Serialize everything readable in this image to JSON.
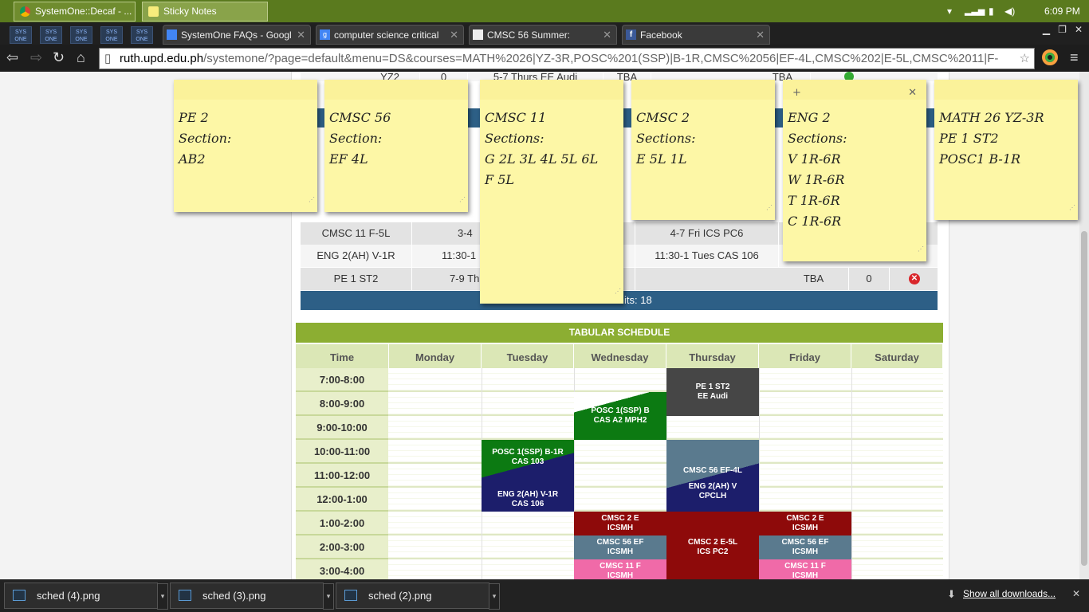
{
  "taskbar": {
    "buttons": [
      "SystemOne::Decaf - ...",
      "Sticky Notes"
    ],
    "clock": "6:09 PM"
  },
  "browser": {
    "pinned_tabs": [
      "SYS ONE",
      "SYS ONE",
      "SYS ONE",
      "SYS ONE",
      "SYS ONE"
    ],
    "tabs": [
      {
        "label": "SystemOne FAQs - Googl"
      },
      {
        "label": "computer science critical"
      },
      {
        "label": "CMSC 56 Summer:"
      },
      {
        "label": "Facebook"
      }
    ],
    "url_host": "ruth.upd.edu.ph",
    "url_path": "/systemone/?page=default&menu=DS&courses=MATH%2026|YZ-3R,POSC%201(SSP)|B-1R,CMSC%2056|EF-4L,CMSC%202|E-5L,CMSC%2011|F-"
  },
  "course_table": {
    "partial_row": [
      "YZ2",
      "0",
      "5-7 Thurs EE Audi",
      "TBA",
      "TBA"
    ],
    "rows": [
      {
        "course": "CMSC 11 F-5L",
        "time": "3-4",
        "lab": "4-7 Fri ICS PC6"
      },
      {
        "course": "ENG 2(AH) V-1R",
        "time": "11:30-1",
        "lab": "11:30-1 Tues CAS 106"
      },
      {
        "course": "PE 1 ST2",
        "time": "7-9 Th",
        "lab": "",
        "room": "TBA",
        "slots": "0"
      }
    ],
    "units_label": "Total Units: 18"
  },
  "schedule": {
    "title": "TABULAR SCHEDULE",
    "columns": [
      "Time",
      "Monday",
      "Tuesday",
      "Wednesday",
      "Thursday",
      "Friday",
      "Saturday"
    ],
    "times": [
      "7:00-8:00",
      "8:00-9:00",
      "9:00-10:00",
      "10:00-11:00",
      "11:00-12:00",
      "12:00-1:00",
      "1:00-2:00",
      "2:00-3:00",
      "3:00-4:00"
    ],
    "blocks": {
      "pe_thu": [
        "PE 1 ST2",
        "EE Audi"
      ],
      "posc_wed": [
        "POSC 1(SSP) B",
        "CAS A2 MPH2"
      ],
      "posc_tue": [
        "POSC 1(SSP) B-1R",
        "CAS 103"
      ],
      "eng_tue": [
        "ENG 2(AH) V-1R",
        "CAS 106"
      ],
      "cmsc56_thu": [
        "CMSC 56 EF-4L"
      ],
      "eng_thu": [
        "ENG 2(AH) V",
        "CPCLH"
      ],
      "cmsc2_wed": [
        "CMSC 2 E",
        "ICSMH"
      ],
      "cmsc2_thu": [
        "CMSC 2 E-5L",
        "ICS PC2"
      ],
      "cmsc2_fri": [
        "CMSC 2 E",
        "ICSMH"
      ],
      "cmsc56_wed": [
        "CMSC 56 EF",
        "ICSMH"
      ],
      "cmsc56_fri": [
        "CMSC 56 EF",
        "ICSMH"
      ],
      "cmsc11_wed": [
        "CMSC 11 F",
        "ICSMH"
      ],
      "cmsc11_fri": [
        "CMSC 11 F",
        "ICSMH"
      ]
    }
  },
  "stickies": [
    {
      "lines": [
        "PE 2",
        "Section:",
        "AB2"
      ]
    },
    {
      "lines": [
        "CMSC 56",
        "Section:",
        "EF 4L"
      ]
    },
    {
      "lines": [
        "CMSC 11",
        "Sections:",
        "G 2L 3L 4L 5L 6L",
        "F 5L"
      ]
    },
    {
      "lines": [
        "CMSC 2",
        "Sections:",
        "E 5L 1L"
      ]
    },
    {
      "lines": [
        "ENG 2",
        "Sections:",
        "V 1R-6R",
        "W 1R-6R",
        "T 1R-6R",
        "C 1R-6R"
      ]
    },
    {
      "lines": [
        "MATH 26 YZ-3R",
        "PE 1 ST2",
        "POSC1 B-1R"
      ]
    }
  ],
  "downloads": {
    "items": [
      "sched (4).png",
      "sched (3).png",
      "sched (2).png"
    ],
    "show_all": "Show all downloads..."
  }
}
